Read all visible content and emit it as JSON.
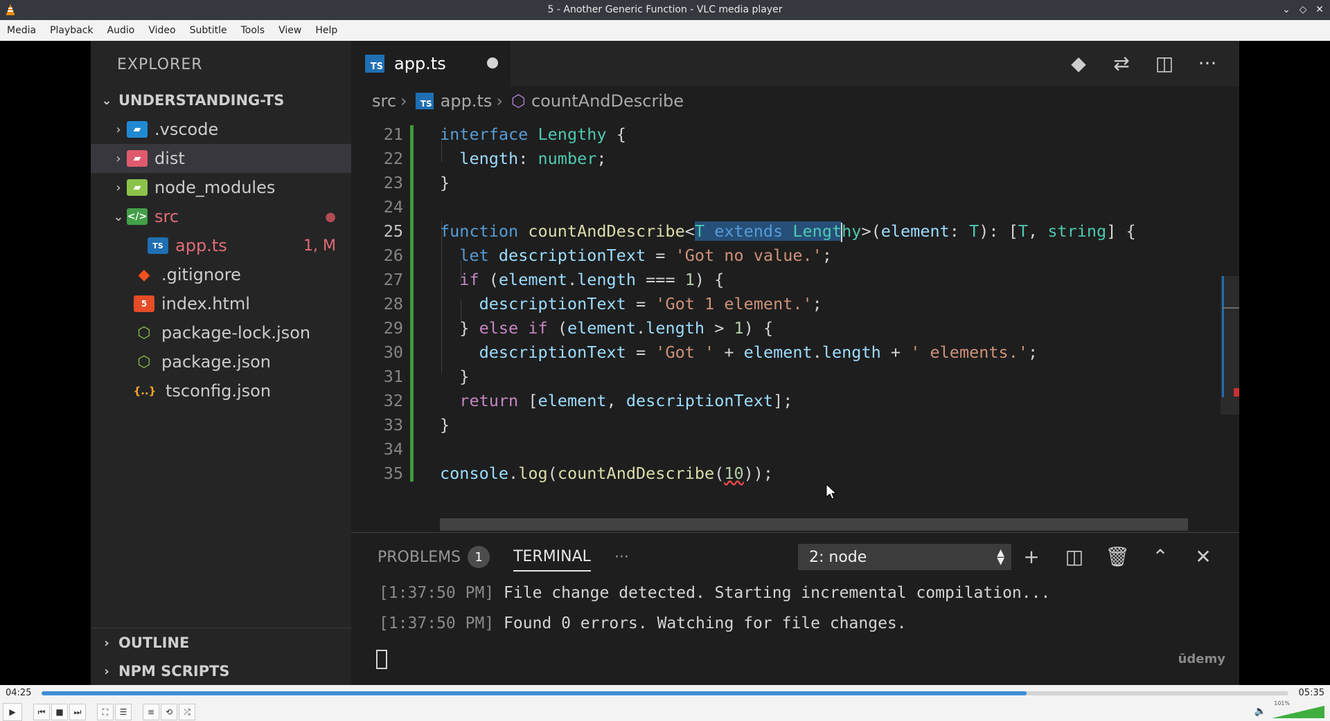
{
  "window": {
    "title": "5 - Another Generic Function - VLC media player"
  },
  "menu": [
    "Media",
    "Playback",
    "Audio",
    "Video",
    "Subtitle",
    "Tools",
    "View",
    "Help"
  ],
  "explorer": {
    "title": "EXPLORER",
    "project": "UNDERSTANDING-TS",
    "items": [
      {
        "name": ".vscode",
        "badge": ""
      },
      {
        "name": "dist",
        "badge": ""
      },
      {
        "name": "node_modules",
        "badge": ""
      },
      {
        "name": "src",
        "badge": "●"
      },
      {
        "name": "app.ts",
        "badge": "1, M"
      },
      {
        "name": ".gitignore",
        "badge": ""
      },
      {
        "name": "index.html",
        "badge": ""
      },
      {
        "name": "package-lock.json",
        "badge": ""
      },
      {
        "name": "package.json",
        "badge": ""
      },
      {
        "name": "tsconfig.json",
        "badge": ""
      }
    ],
    "outline": "OUTLINE",
    "npm_scripts": "NPM SCRIPTS"
  },
  "editor": {
    "tab": {
      "label": "app.ts",
      "icon": "TS"
    },
    "breadcrumb": [
      "src",
      "app.ts",
      "countAndDescribe"
    ],
    "line_numbers": [
      "21",
      "22",
      "23",
      "24",
      "25",
      "26",
      "27",
      "28",
      "29",
      "30",
      "31",
      "32",
      "33",
      "34",
      "35"
    ]
  },
  "panel": {
    "problems_label": "PROBLEMS",
    "problems_count": "1",
    "terminal_label": "TERMINAL",
    "more": "···",
    "terminal_select": "2: node",
    "lines": [
      {
        "time": "[1:37:50 PM]",
        "text": "File change detected. Starting incremental compilation..."
      },
      {
        "time": "[1:37:50 PM]",
        "text": "Found 0 errors. Watching for file changes."
      }
    ],
    "watermark": "ūdemy"
  },
  "player": {
    "elapsed": "04:25",
    "total": "05:35",
    "progress": 0.79,
    "volume_label": "101%",
    "volume_level": 1.01
  },
  "colors": {
    "accent": "#3d8fd6",
    "editor_bg": "#1e1e1e",
    "sidebar_bg": "#252526"
  }
}
